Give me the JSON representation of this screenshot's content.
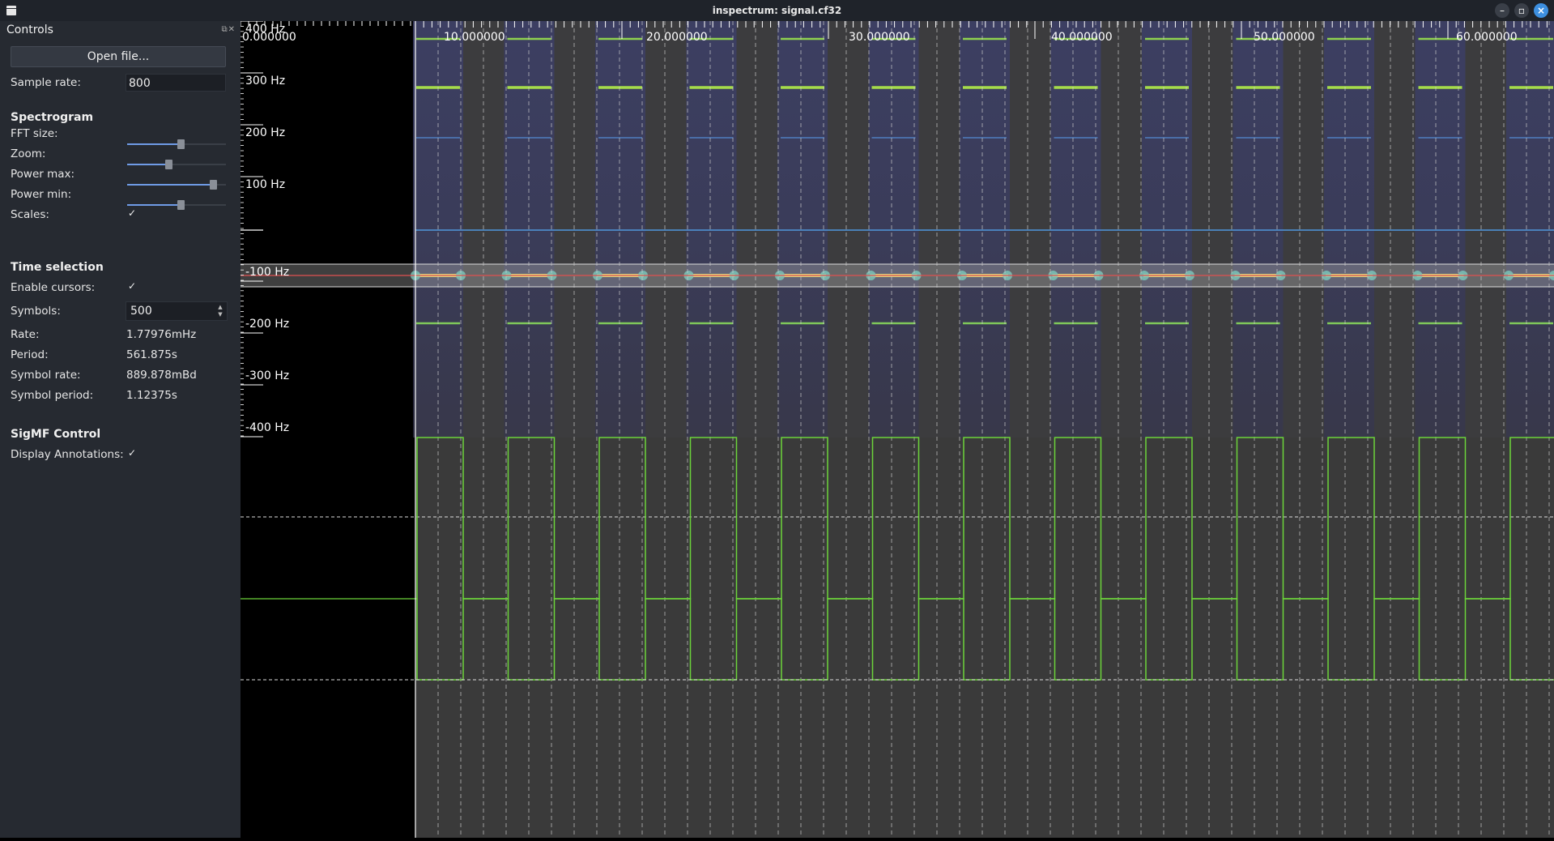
{
  "window": {
    "title": "inspectrum: signal.cf32"
  },
  "dock": {
    "title": "Controls",
    "open_file": "Open file...",
    "sample_rate_label": "Sample rate:",
    "sample_rate_value": "800",
    "spectrogram": {
      "heading": "Spectrogram",
      "fft_size_label": "FFT size:",
      "fft_size_level": 0.55,
      "zoom_label": "Zoom:",
      "zoom_level": 0.42,
      "power_max_label": "Power max:",
      "power_max_level": 0.9,
      "power_min_label": "Power min:",
      "power_min_level": 0.55,
      "scales_label": "Scales:",
      "scales_check": "✓"
    },
    "time_selection": {
      "heading": "Time selection",
      "enable_cursors_label": "Enable cursors:",
      "enable_cursors_check": "✓",
      "symbols_label": "Symbols:",
      "symbols_value": "500",
      "rate_label": "Rate:",
      "rate_value": "1.77976mHz",
      "period_label": "Period:",
      "period_value": "561.875s",
      "symbol_rate_label": "Symbol rate:",
      "symbol_rate_value": "889.878mBd",
      "symbol_period_label": "Symbol period:",
      "symbol_period_value": "1.12375s"
    },
    "sigmf": {
      "heading": "SigMF Control",
      "display_annotations_label": "Display Annotations:",
      "display_annotations_check": "✓"
    }
  },
  "spectrogram_view": {
    "freq_labels": [
      "400 Hz",
      "300 Hz",
      "200 Hz",
      "100 Hz",
      "-100 Hz",
      "-200 Hz",
      "-300 Hz",
      "-400 Hz"
    ],
    "time_labels": [
      "0.000000",
      "10.000000",
      "20.000000",
      "30.000000",
      "40.000000",
      "50.000000",
      "60.000000"
    ]
  },
  "colors": {
    "trace": "#6cd43a",
    "plot_bg": "#3a3a3a",
    "cursor_band": "#b4b4b4",
    "center_line": "#e05050",
    "accent": "#6f9be6"
  }
}
